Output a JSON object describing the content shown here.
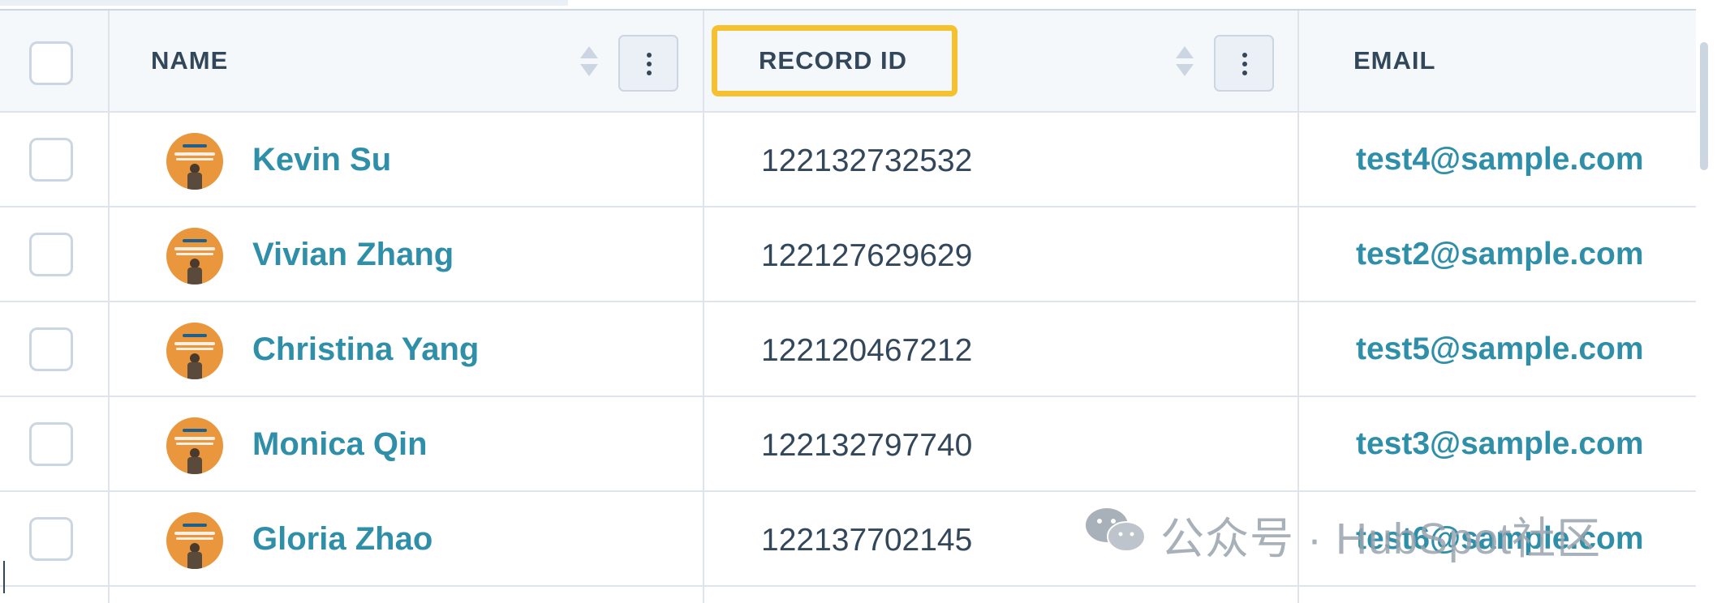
{
  "table": {
    "columns": {
      "name": {
        "label": "NAME"
      },
      "record_id": {
        "label": "RECORD ID"
      },
      "email": {
        "label": "EMAIL"
      }
    },
    "rows": [
      {
        "name": "Kevin Su",
        "record_id": "122132732532",
        "email": "test4@sample.com"
      },
      {
        "name": "Vivian Zhang",
        "record_id": "122127629629",
        "email": "test2@sample.com"
      },
      {
        "name": "Christina Yang",
        "record_id": "122120467212",
        "email": "test5@sample.com"
      },
      {
        "name": "Monica Qin",
        "record_id": "122132797740",
        "email": "test3@sample.com"
      },
      {
        "name": "Gloria Zhao",
        "record_id": "122137702145",
        "email": "test6@sample.com"
      }
    ]
  },
  "watermark": {
    "text": "公众号 · HubSpot社区"
  },
  "icons": {
    "sort": "sort-arrows-icon",
    "menu": "vertical-dots-icon",
    "avatar": "avatar-logo-icon",
    "watermark": "wechat-icon"
  },
  "colors": {
    "link": "#2f8fa8",
    "text": "#33475b",
    "header_bg": "#f5f8fa",
    "border": "#dfe3eb",
    "highlight": "#f5c12e",
    "avatar_bg": "#e9963c"
  }
}
